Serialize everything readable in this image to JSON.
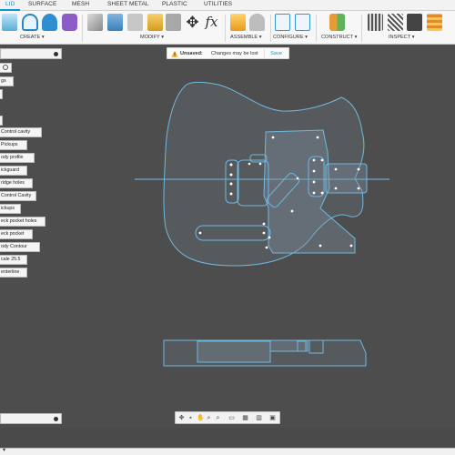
{
  "tabs": [
    "LID",
    "SURFACE",
    "MESH",
    "SHEET METAL",
    "PLASTIC",
    "UTILITIES"
  ],
  "toolbar": {
    "groups": [
      "CREATE ▾",
      "MODIFY ▾",
      "ASSEMBLE ▾",
      "CONFIGURE ▾",
      "CONSTRUCT ▾",
      "INSPECT ▾"
    ],
    "fx_label": "fx"
  },
  "unsaved": {
    "title": "Unsaved:",
    "message": "Changes may be lost",
    "save_label": "Save"
  },
  "browser": {
    "items": [
      {
        "label": ""
      },
      {
        "label": "gs"
      },
      {
        "label": ""
      },
      {
        "label": ""
      },
      {
        "label": "Control cavity"
      },
      {
        "label": "Pickups"
      },
      {
        "label": "ody profile"
      },
      {
        "label": "ickguard"
      },
      {
        "label": "ridge holes"
      },
      {
        "label": "Control Cavity"
      },
      {
        "label": "ickups"
      },
      {
        "label": "eck pocket holes"
      },
      {
        "label": "eck pocket"
      },
      {
        "label": "ody Contour"
      },
      {
        "label": "cale 25.5"
      },
      {
        "label": "enterline"
      }
    ]
  },
  "colors": {
    "accent": "#0696d7",
    "canvas": "#4d4d4d",
    "sketch_line": "#6fb8e0",
    "sketch_fill": "#7d8c97"
  }
}
